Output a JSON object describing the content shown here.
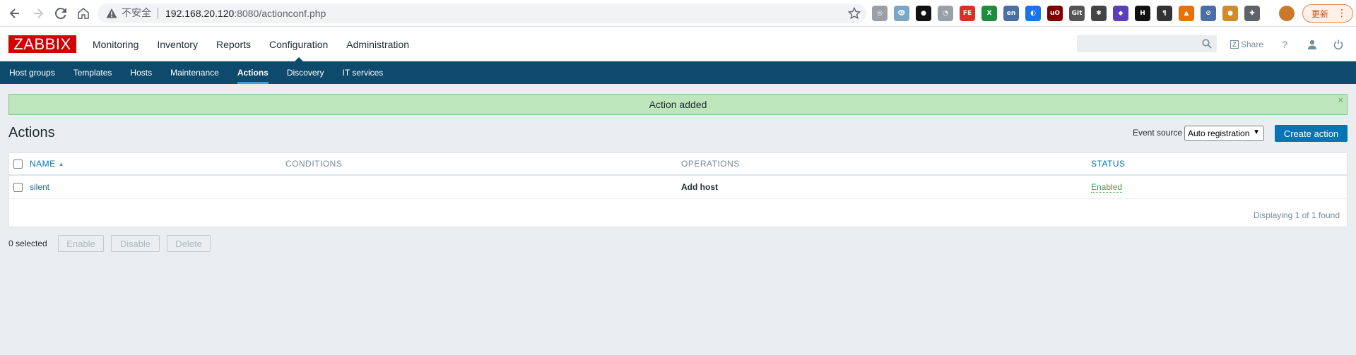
{
  "browser": {
    "insecure_label": "不安全",
    "url_host": "192.168.20.120",
    "url_rest": ":8080/actionconf.php",
    "update_label": "更新",
    "extensions": [
      {
        "name": "extension-1-icon",
        "color": "#9aa0a6",
        "glyph": "◎"
      },
      {
        "name": "extension-2-icon",
        "color": "#7aa7c7",
        "glyph": "👁"
      },
      {
        "name": "extension-3-icon",
        "color": "#111111",
        "glyph": "●"
      },
      {
        "name": "extension-4-icon",
        "color": "#9aa0a6",
        "glyph": "◔"
      },
      {
        "name": "extension-fe-icon",
        "color": "#d93025",
        "glyph": "FE"
      },
      {
        "name": "extension-excel-icon",
        "color": "#1e8e3e",
        "glyph": "X"
      },
      {
        "name": "extension-translate-icon",
        "color": "#4a6fa5",
        "glyph": "en"
      },
      {
        "name": "extension-6-icon",
        "color": "#1a73e8",
        "glyph": "◐"
      },
      {
        "name": "extension-ublock-icon",
        "color": "#800000",
        "glyph": "uO"
      },
      {
        "name": "extension-gitzip-icon",
        "color": "#555555",
        "glyph": "Git"
      },
      {
        "name": "extension-9-icon",
        "color": "#444444",
        "glyph": "✱"
      },
      {
        "name": "extension-10-icon",
        "color": "#5b3fb8",
        "glyph": "◆"
      },
      {
        "name": "extension-h-icon",
        "color": "#111111",
        "glyph": "H"
      },
      {
        "name": "extension-pilcrow-icon",
        "color": "#333333",
        "glyph": "¶"
      },
      {
        "name": "extension-13-icon",
        "color": "#e8710a",
        "glyph": "▲"
      },
      {
        "name": "extension-14-icon",
        "color": "#4a6fa5",
        "glyph": "⊘"
      },
      {
        "name": "extension-cookie-icon",
        "color": "#d28b2a",
        "glyph": "●"
      },
      {
        "name": "extensions-puzzle-icon",
        "color": "#5f6368",
        "glyph": "✚"
      }
    ]
  },
  "header": {
    "logo": "ZABBIX",
    "menu": [
      "Monitoring",
      "Inventory",
      "Reports",
      "Configuration",
      "Administration"
    ],
    "active_menu": "Configuration",
    "search_placeholder": "",
    "share_label": "Share",
    "help_glyph": "?"
  },
  "submenu": {
    "items": [
      "Host groups",
      "Templates",
      "Hosts",
      "Maintenance",
      "Actions",
      "Discovery",
      "IT services"
    ],
    "active": "Actions"
  },
  "message": {
    "text": "Action added",
    "close_glyph": "×"
  },
  "page": {
    "title": "Actions",
    "filter_label": "Event source",
    "event_source_value": "Auto registration",
    "create_label": "Create action"
  },
  "table": {
    "columns": [
      "NAME",
      "CONDITIONS",
      "OPERATIONS",
      "STATUS"
    ],
    "sort_indicator": "▲",
    "rows": [
      {
        "name": "silent",
        "conditions": "",
        "operations": "Add host",
        "status": "Enabled"
      }
    ],
    "paging": "Displaying 1 of 1 found"
  },
  "footer": {
    "selected": "0 selected",
    "buttons": [
      "Enable",
      "Disable",
      "Delete"
    ]
  }
}
